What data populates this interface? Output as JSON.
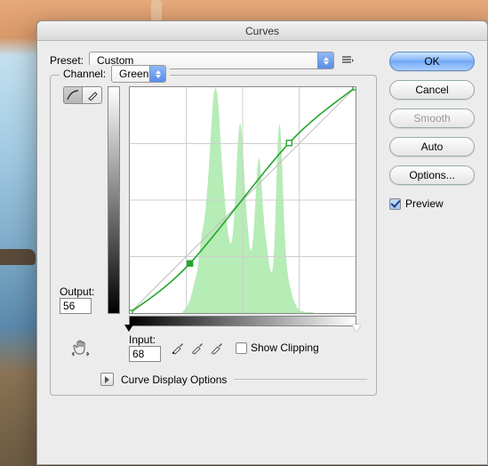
{
  "window": {
    "title": "Curves"
  },
  "preset": {
    "label": "Preset:",
    "value": "Custom"
  },
  "channel": {
    "label": "Channel:",
    "value": "Green"
  },
  "output": {
    "label": "Output:",
    "value": "56"
  },
  "input": {
    "label": "Input:",
    "value": "68"
  },
  "show_clipping": {
    "label": "Show Clipping",
    "checked": false
  },
  "curve_display": {
    "label": "Curve Display Options"
  },
  "buttons": {
    "ok": "OK",
    "cancel": "Cancel",
    "smooth": "Smooth",
    "auto": "Auto",
    "options": "Options..."
  },
  "preview": {
    "label": "Preview",
    "checked": true
  },
  "chart_data": {
    "type": "line",
    "title": "",
    "xlabel": "Input",
    "ylabel": "Output",
    "xlim": [
      0,
      255
    ],
    "ylim": [
      0,
      255
    ],
    "grid": true,
    "curve_points": [
      {
        "x": 0,
        "y": 0
      },
      {
        "x": 68,
        "y": 56
      },
      {
        "x": 180,
        "y": 192
      },
      {
        "x": 255,
        "y": 255
      }
    ],
    "selected_point_index": 1,
    "baseline": "y=x",
    "histogram": [
      0,
      0,
      0,
      0,
      0,
      0,
      0,
      0,
      0,
      0,
      0,
      0,
      0,
      0,
      0,
      0,
      0,
      0,
      0,
      0,
      0,
      0,
      0,
      0,
      0,
      0,
      0,
      0,
      0,
      0,
      0,
      0,
      0,
      0,
      0,
      0,
      0,
      0,
      0,
      0,
      0,
      0,
      0,
      0,
      0,
      0,
      0,
      0,
      0,
      0,
      0,
      0,
      0,
      0,
      0,
      0,
      0,
      0,
      0,
      0,
      2,
      3,
      4,
      5,
      6,
      8,
      10,
      12,
      15,
      18,
      22,
      26,
      30,
      34,
      38,
      42,
      46,
      54,
      62,
      70,
      78,
      86,
      93,
      98,
      104,
      112,
      122,
      134,
      146,
      160,
      176,
      192,
      208,
      224,
      238,
      248,
      252,
      255,
      252,
      246,
      236,
      222,
      204,
      186,
      170,
      156,
      144,
      132,
      120,
      108,
      98,
      90,
      84,
      80,
      78,
      80,
      86,
      96,
      110,
      128,
      150,
      172,
      190,
      204,
      212,
      214,
      208,
      196,
      180,
      162,
      144,
      128,
      114,
      100,
      88,
      78,
      72,
      70,
      74,
      82,
      94,
      110,
      128,
      146,
      162,
      172,
      176,
      170,
      158,
      142,
      126,
      112,
      100,
      90,
      82,
      74,
      66,
      58,
      52,
      48,
      46,
      48,
      56,
      72,
      96,
      128,
      160,
      188,
      206,
      214,
      210,
      194,
      170,
      142,
      114,
      90,
      72,
      58,
      48,
      40,
      34,
      30,
      26,
      22,
      18,
      15,
      12,
      10,
      8,
      6,
      5,
      4,
      3,
      2,
      2,
      2,
      2,
      1,
      1,
      1,
      1,
      1,
      1,
      1,
      1,
      1,
      1,
      1,
      0,
      0,
      0,
      0,
      0,
      0,
      0,
      0,
      0,
      0,
      0,
      0,
      0,
      0,
      0,
      0,
      0,
      0,
      0,
      0,
      0,
      0,
      0,
      0,
      0,
      0,
      0,
      0,
      0,
      0,
      0,
      0,
      0,
      0,
      0,
      0,
      0,
      0,
      0,
      0,
      0,
      0,
      0,
      0,
      0,
      0,
      0,
      0
    ]
  }
}
